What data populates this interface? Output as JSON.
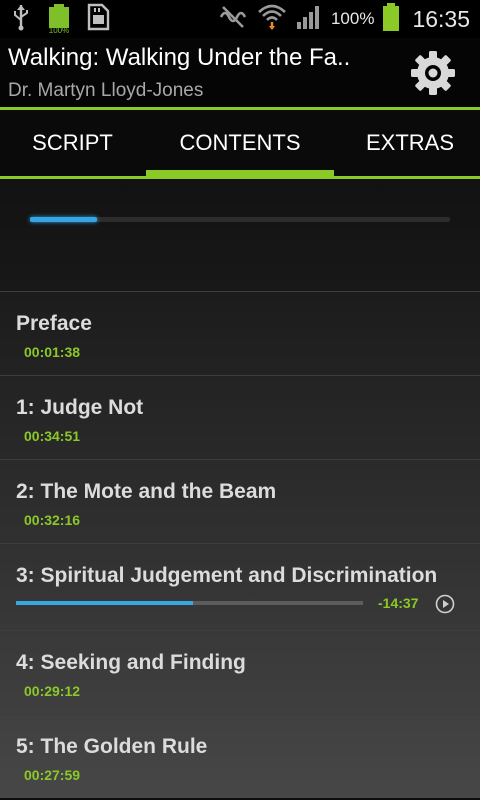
{
  "status_bar": {
    "icons": [
      "usb-icon",
      "battery-full-icon",
      "sd-card-icon",
      "mute-icon",
      "wifi-icon",
      "signal-icon",
      "battery-icon"
    ],
    "battery_small_label": "100%",
    "battery_percent": "100%",
    "time": "16:35"
  },
  "header": {
    "title": "Walking: Walking Under the Fa..",
    "subtitle": "Dr. Martyn Lloyd-Jones",
    "settings_icon": "gear-icon"
  },
  "tabs": [
    {
      "label": "SCRIPT",
      "active": false
    },
    {
      "label": "CONTENTS",
      "active": true
    },
    {
      "label": "EXTRAS",
      "active": false
    }
  ],
  "overall_progress": 0.16,
  "chapters": [
    {
      "title": "Preface",
      "duration": "00:01:38"
    },
    {
      "title": "1: Judge Not",
      "duration": "00:34:51"
    },
    {
      "title": "2: The Mote and the Beam",
      "duration": "00:32:16"
    },
    {
      "title": "3: Spiritual Judgement and Discrimination",
      "remaining": "-14:37",
      "progress": 0.51,
      "playing": true
    },
    {
      "title": "4: Seeking and Finding",
      "duration": "00:29:12"
    },
    {
      "title": "5: The Golden Rule",
      "duration": "00:27:59"
    }
  ],
  "colors": {
    "accent_green": "#8ac926",
    "progress_blue": "#36a6e2",
    "background": "#0d0d0d"
  }
}
